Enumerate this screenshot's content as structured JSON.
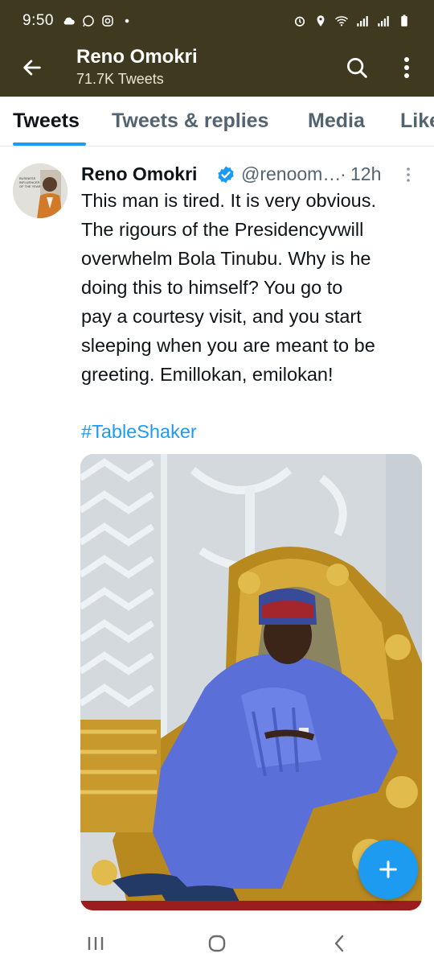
{
  "status_bar": {
    "time": "9:50",
    "left_icons": [
      "cloud-icon",
      "whatsapp-icon",
      "instagram-icon",
      "notification-dot-icon"
    ],
    "right_icons": [
      "alarm-icon",
      "location-icon",
      "wifi-icon",
      "signal-icon",
      "signal-icon",
      "battery-icon"
    ]
  },
  "header": {
    "title": "Reno Omokri",
    "subtitle": "71.7K Tweets",
    "background": "#3f3a1f"
  },
  "tabs": [
    {
      "label": "Tweets",
      "active": true
    },
    {
      "label": "Tweets & replies",
      "active": false
    },
    {
      "label": "Media",
      "active": false
    },
    {
      "label": "Likes",
      "active": false
    }
  ],
  "tweet": {
    "author_name": "Reno Omokri",
    "handle": "@renoom…",
    "separator": "·",
    "time": "12h",
    "verified": true,
    "text_lines": [
      "This man is tired. It is very obvious.",
      "The rigours of the Presidencyvwill",
      "overwhelm Bola Tinubu. Why is he",
      "doing this to himself? You go to",
      "pay a courtesy visit, and you start",
      "sleeping when you are meant to be",
      "greeting. Emillokan, emilokan!"
    ],
    "hashtag": "#TableShaker",
    "avatar_text": [
      "BUSINESS",
      "INFLUENCER",
      "OF THE YEAR"
    ]
  },
  "fab": {
    "icon": "plus-icon"
  },
  "colors": {
    "accent": "#1d9bf0",
    "text_primary": "#0f1419",
    "text_secondary": "#536471"
  }
}
